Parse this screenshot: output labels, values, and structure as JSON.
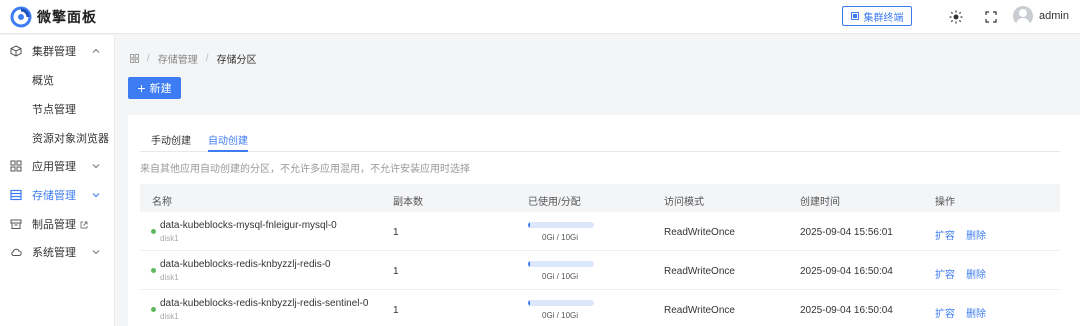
{
  "app": {
    "title": "微擎面板"
  },
  "header": {
    "terminal_label": "集群终端",
    "username": "admin"
  },
  "sidebar": {
    "items": [
      {
        "label": "集群管理"
      },
      {
        "label": "应用管理"
      },
      {
        "label": "存储管理"
      },
      {
        "label": "制品管理"
      },
      {
        "label": "系统管理"
      }
    ],
    "cluster_children": [
      "概览",
      "节点管理",
      "资源对象浏览器"
    ]
  },
  "breadcrumb": {
    "level1": "存储管理",
    "level2": "存储分区"
  },
  "toolbar": {
    "new_label": "新建"
  },
  "tabs": [
    "手动创建",
    "自动创建"
  ],
  "hint": "来自其他应用自动创建的分区，不允许多应用混用，不允许安装应用时选择",
  "table": {
    "columns": [
      "名称",
      "副本数",
      "已使用/分配",
      "访问模式",
      "创建时间",
      "操作"
    ],
    "rows": [
      {
        "name": "data-kubeblocks-mysql-fnleigur-mysql-0",
        "disk": "disk1",
        "replicas": "1",
        "usage": "0Gi / 10Gi",
        "usage_fraction": 0.02,
        "access_mode": "ReadWriteOnce",
        "created": "2025-09-04 15:56:01",
        "expand": "扩容",
        "delete": "删除"
      },
      {
        "name": "data-kubeblocks-redis-knbyzzlj-redis-0",
        "disk": "disk1",
        "replicas": "1",
        "usage": "0Gi / 10Gi",
        "usage_fraction": 0.02,
        "access_mode": "ReadWriteOnce",
        "created": "2025-09-04 16:50:04",
        "expand": "扩容",
        "delete": "删除"
      },
      {
        "name": "data-kubeblocks-redis-knbyzzlj-redis-sentinel-0",
        "disk": "disk1",
        "replicas": "1",
        "usage": "0Gi / 10Gi",
        "usage_fraction": 0.02,
        "access_mode": "ReadWriteOnce",
        "created": "2025-09-04 16:50:04",
        "expand": "扩容",
        "delete": "删除"
      }
    ]
  },
  "colors": {
    "accent": "#3d7cf2",
    "status_ok": "#5cb85c"
  }
}
